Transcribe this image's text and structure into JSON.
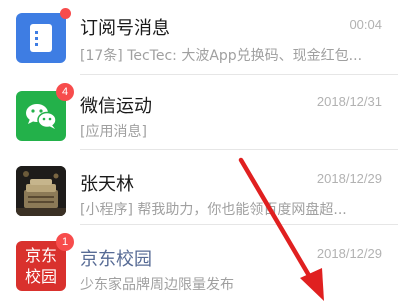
{
  "conversations": [
    {
      "title": "订阅号消息",
      "subtitle": "[17条] TecTec: 大波App兑换码、现金红包...",
      "time": "00:04",
      "icon": "document-icon",
      "icon_color": "#3e7de3",
      "badge": "dot"
    },
    {
      "title": "微信运动",
      "subtitle": "[应用消息]",
      "time": "2018/12/31",
      "icon": "wechat-icon",
      "icon_color": "#23b14a",
      "badge": "4"
    },
    {
      "title": "张天林",
      "subtitle": "[小程序] 帮我助力，你也能领百度网盘超...",
      "time": "2018/12/29",
      "icon": "user-photo-avatar",
      "badge": ""
    },
    {
      "title": "京东校园",
      "subtitle": "少东家品牌周边限量发布",
      "time": "2018/12/29",
      "icon": "jd-logo",
      "icon_color": "#d9312d",
      "logo_text": [
        "京东",
        "校园"
      ],
      "badge": "1"
    }
  ],
  "annotation": {
    "type": "arrow",
    "color": "#e02020"
  }
}
